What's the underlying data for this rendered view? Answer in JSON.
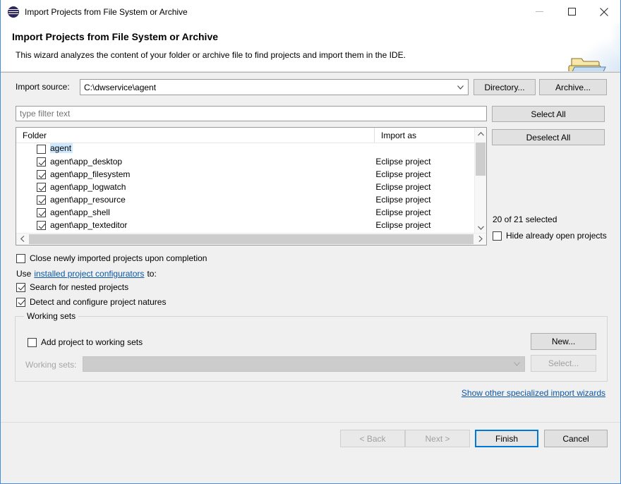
{
  "window": {
    "title": "Import Projects from File System or Archive",
    "app_icon": "eclipse-icon",
    "minimize_label": "minimize-icon",
    "maximize_label": "maximize-icon",
    "close_label": "close-icon"
  },
  "header": {
    "title": "Import Projects from File System or Archive",
    "description": "This wizard analyzes the content of your folder or archive file to find projects and import them in the IDE.",
    "icon": "folder-icon"
  },
  "source": {
    "label": "Import source:",
    "value": "C:\\dwservice\\agent",
    "directory_button": "Directory...",
    "archive_button": "Archive..."
  },
  "filter": {
    "placeholder": "type filter text",
    "value": ""
  },
  "tree": {
    "columns": [
      "Folder",
      "Import as"
    ],
    "rows": [
      {
        "name": "agent",
        "checked": false,
        "selected": true,
        "import_as": ""
      },
      {
        "name": "agent\\app_desktop",
        "checked": true,
        "selected": false,
        "import_as": "Eclipse project"
      },
      {
        "name": "agent\\app_filesystem",
        "checked": true,
        "selected": false,
        "import_as": "Eclipse project"
      },
      {
        "name": "agent\\app_logwatch",
        "checked": true,
        "selected": false,
        "import_as": "Eclipse project"
      },
      {
        "name": "agent\\app_resource",
        "checked": true,
        "selected": false,
        "import_as": "Eclipse project"
      },
      {
        "name": "agent\\app_shell",
        "checked": true,
        "selected": false,
        "import_as": "Eclipse project"
      },
      {
        "name": "agent\\app_texteditor",
        "checked": true,
        "selected": false,
        "import_as": "Eclipse project"
      }
    ]
  },
  "side": {
    "select_all": "Select All",
    "deselect_all": "Deselect All",
    "selection_count": "20 of 21 selected",
    "hide_open": {
      "label": "Hide already open projects",
      "checked": false
    }
  },
  "options": {
    "close_imported": {
      "label": "Close newly imported projects upon completion",
      "checked": false
    },
    "use_prefix": "Use",
    "configurators_link": "installed project configurators",
    "use_suffix": "to:",
    "search_nested": {
      "label": "Search for nested projects",
      "checked": true
    },
    "detect_natures": {
      "label": "Detect and configure project natures",
      "checked": true
    }
  },
  "working_sets": {
    "group_title": "Working sets",
    "add_checkbox": {
      "label": "Add project to working sets",
      "checked": false
    },
    "new_button": "New...",
    "select_button": "Select...",
    "field_label": "Working sets:",
    "field_value": ""
  },
  "specialized_link": "Show other specialized import wizards",
  "footer": {
    "back": "< Back",
    "next": "Next >",
    "finish": "Finish",
    "cancel": "Cancel"
  },
  "colors": {
    "accent": "#0078d7",
    "link": "#0b57a4",
    "selection": "#cde8ff"
  }
}
